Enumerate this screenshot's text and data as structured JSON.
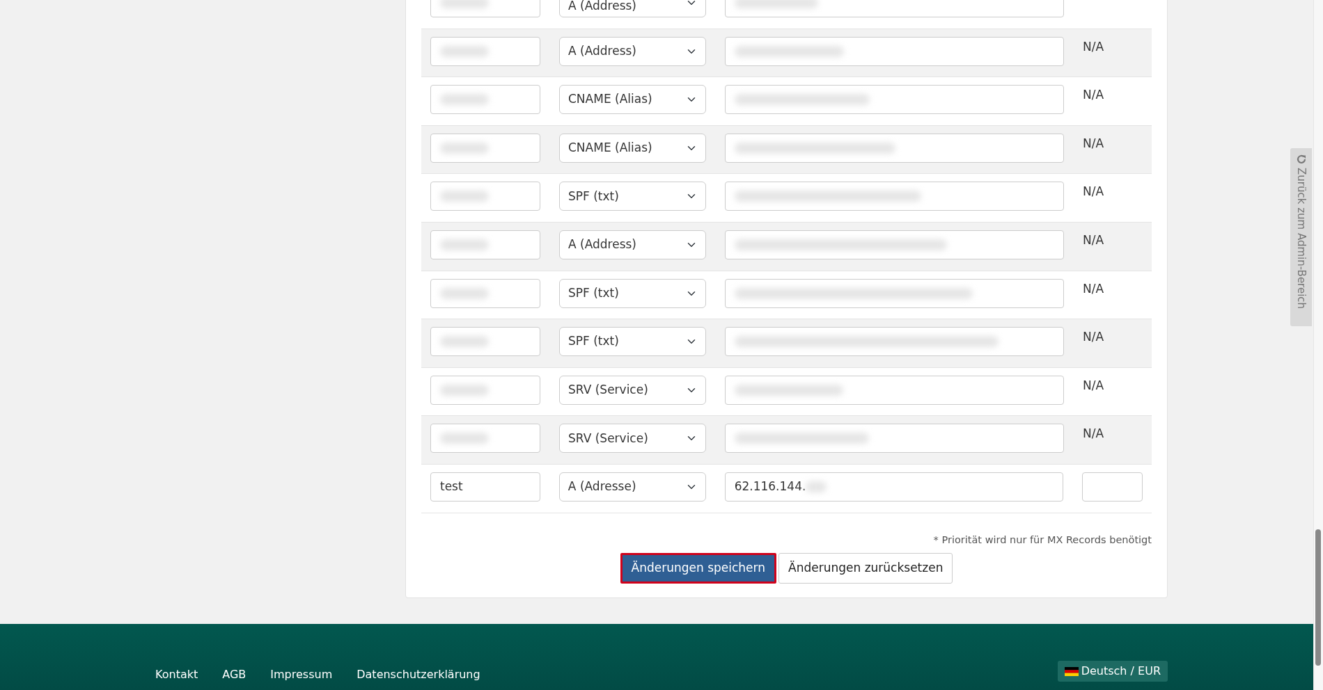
{
  "dns_records": [
    {
      "kind": "existing",
      "name_redacted": true,
      "type": "A (Address)",
      "value_redacted": true
    },
    {
      "kind": "existing",
      "name_redacted": true,
      "type": "A (Address)",
      "value_redacted": true,
      "priority": "N/A"
    },
    {
      "kind": "existing",
      "name_redacted": true,
      "type": "CNAME (Alias)",
      "value_redacted": true,
      "priority": "N/A"
    },
    {
      "kind": "existing",
      "name_redacted": true,
      "type": "CNAME (Alias)",
      "value_redacted": true,
      "priority": "N/A"
    },
    {
      "kind": "existing",
      "name_redacted": true,
      "type": "SPF (txt)",
      "value_redacted": true,
      "priority": "N/A"
    },
    {
      "kind": "existing",
      "name_redacted": true,
      "type": "A (Address)",
      "value_redacted": true,
      "priority": "N/A"
    },
    {
      "kind": "existing",
      "name_redacted": true,
      "type": "SPF (txt)",
      "value_redacted": true,
      "priority": "N/A"
    },
    {
      "kind": "existing",
      "name_redacted": true,
      "type": "SPF (txt)",
      "value_redacted": true,
      "priority": "N/A"
    },
    {
      "kind": "existing",
      "name_redacted": true,
      "type": "SRV (Service)",
      "value_redacted": true,
      "priority": "N/A"
    },
    {
      "kind": "existing",
      "name_redacted": true,
      "type": "SRV (Service)",
      "value_redacted": true,
      "priority": "N/A"
    },
    {
      "kind": "new",
      "name": "test",
      "name_redacted": false,
      "type": "A (Adresse)",
      "value": "62.116.144.",
      "value_redacted": true
    }
  ],
  "footnote": "* Priorität wird nur für MX Records benötigt",
  "buttons": [
    {
      "label": "Änderungen speichern",
      "kind": "primary",
      "focused": true
    },
    {
      "label": "Änderungen zurücksetzen",
      "kind": "secondary",
      "focused": false
    }
  ],
  "side_tab": {
    "label": "Zurück zum Admin-Bereich"
  },
  "footer": {
    "links": [
      "Kontakt",
      "AGB",
      "Impressum",
      "Datenschutzerklärung"
    ],
    "language": "Deutsch / EUR"
  }
}
